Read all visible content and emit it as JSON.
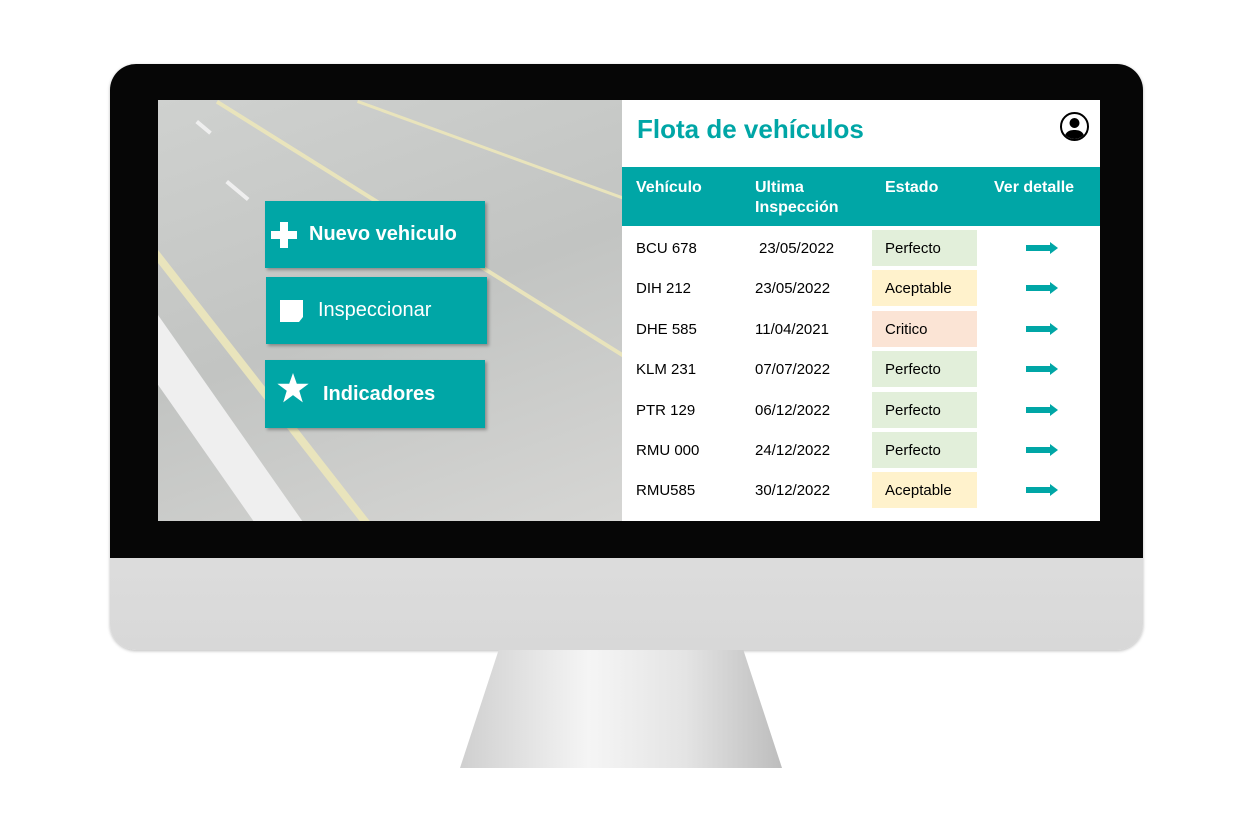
{
  "app": {
    "title": "Flota de vehículos",
    "user_icon": "user-icon"
  },
  "actions": [
    {
      "label": "Nuevo vehiculo",
      "icon": "plus-icon"
    },
    {
      "label": "Inspeccionar",
      "icon": "note-icon"
    },
    {
      "label": "Indicadores",
      "icon": "star-icon"
    }
  ],
  "table": {
    "headers": [
      "Vehículo",
      "Ultima Inspección",
      "Estado",
      "Ver detalle"
    ],
    "rows": [
      {
        "vehicle": "BCU 678",
        "date": "23/05/2022",
        "status": "Perfecto"
      },
      {
        "vehicle": "DIH 212",
        "date": "23/05/2022",
        "status": "Aceptable"
      },
      {
        "vehicle": "DHE 585",
        "date": "11/04/2021",
        "status": "Critico"
      },
      {
        "vehicle": "KLM 231",
        "date": "07/07/2022",
        "status": "Perfecto"
      },
      {
        "vehicle": "PTR 129",
        "date": "06/12/2022",
        "status": "Perfecto"
      },
      {
        "vehicle": "RMU 000",
        "date": "24/12/2022",
        "status": "Perfecto"
      },
      {
        "vehicle": "RMU585",
        "date": "30/12/2022",
        "status": "Aceptable"
      }
    ]
  },
  "colors": {
    "accent": "#00a6a6",
    "Perfecto": "#e2efda",
    "Aceptable": "#fff2cc",
    "Critico": "#fbe4d5"
  }
}
